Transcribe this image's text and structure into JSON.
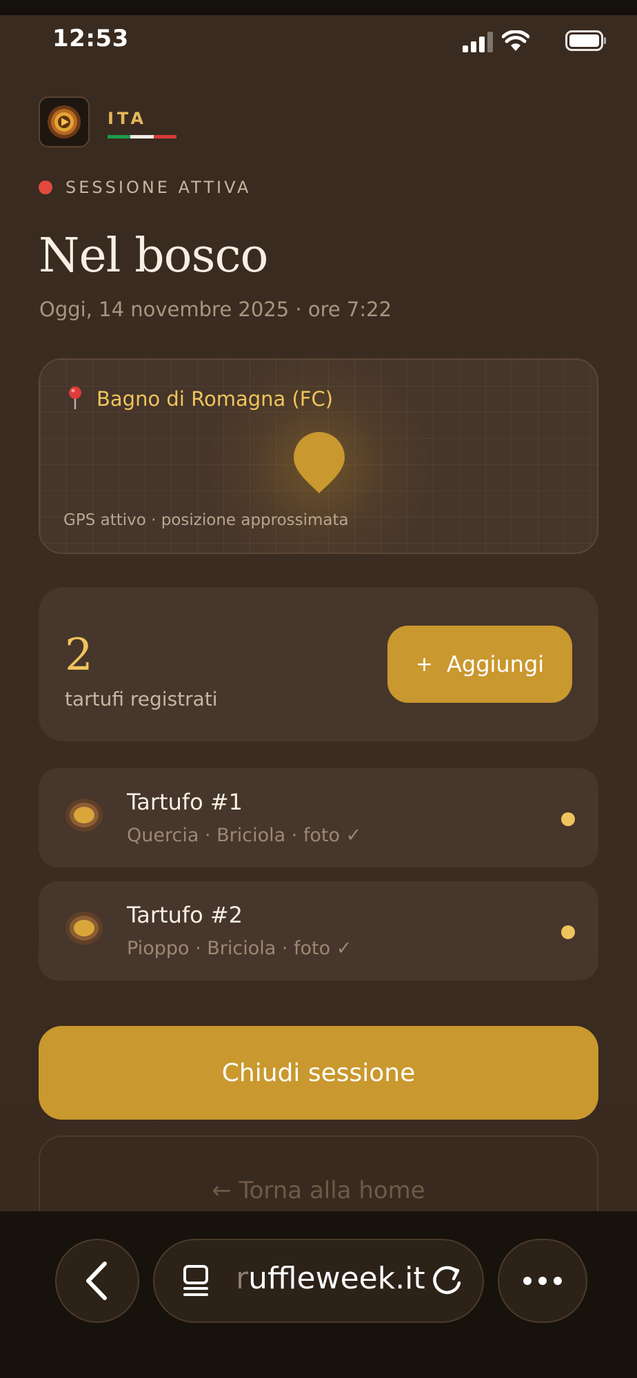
{
  "status_bar": {
    "time": "12:53"
  },
  "header": {
    "language": "ITA",
    "flag_colors": [
      "#1e9a4b",
      "#f2ede6",
      "#d63b3b"
    ]
  },
  "session": {
    "status_label": "SESSIONE ATTIVA",
    "title": "Nel bosco",
    "subtitle": "Oggi, 14 novembre 2025 · ore 7:22"
  },
  "map": {
    "location": "Bagno di Romagna (FC)",
    "gps_note": "GPS attivo · posizione approssimata",
    "pin_icon": "map-pin-icon"
  },
  "counter": {
    "count": "2",
    "label": "tartufi registrati",
    "add_plus": "+",
    "add_label": "Aggiungi"
  },
  "truffles": [
    {
      "title": "Tartufo #1",
      "details": "Quercia · Briciola · foto ✓"
    },
    {
      "title": "Tartufo #2",
      "details": "Pioppo · Briciola · foto ✓"
    }
  ],
  "actions": {
    "close_session": "Chiudi sessione",
    "back_home": "← Torna alla home"
  },
  "browser": {
    "url_faded": "r",
    "url_rest": "uffleweek.it"
  },
  "colors": {
    "accent": "#c9982e",
    "accent_light": "#f0c45c",
    "background": "#3a2b20",
    "card": "#46362b",
    "recording_dot": "#e24a3d"
  }
}
